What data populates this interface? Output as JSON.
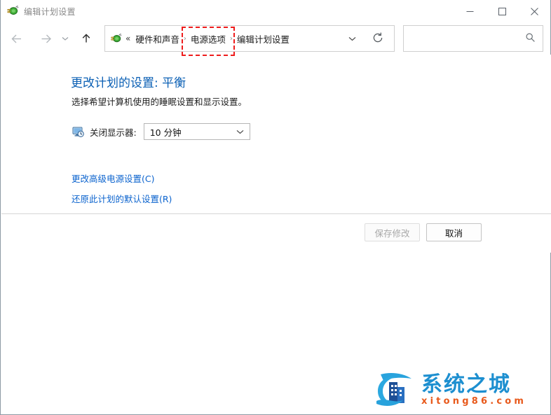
{
  "window": {
    "title": "编辑计划设置",
    "title_icon": "power-plug-icon",
    "controls": {
      "minimize_label": "—",
      "maximize_label": "□",
      "close_label": "✕"
    }
  },
  "navbar": {
    "back_icon": "arrow-left-icon",
    "forward_icon": "arrow-right-icon",
    "recent_icon": "chevron-down-small-icon",
    "up_icon": "arrow-up-icon",
    "address": {
      "icon": "power-plug-icon",
      "overflow_label": "«",
      "crumbs": [
        {
          "label": "硬件和声音"
        },
        {
          "label": "电源选项"
        },
        {
          "label": "编辑计划设置"
        }
      ],
      "separator": "›",
      "dropdown_icon": "chevron-down-icon",
      "refresh_icon": "refresh-icon"
    },
    "search": {
      "value": "",
      "placeholder": "",
      "icon": "search-icon"
    }
  },
  "annotation": {
    "name": "red-dashed-highlight",
    "target": "电源选项",
    "color": "#ee1c1c"
  },
  "content": {
    "heading": "更改计划的设置: 平衡",
    "subtitle": "选择希望计算机使用的睡眠设置和显示设置。",
    "setting": {
      "icon": "monitor-clock-icon",
      "label": "关闭显示器:",
      "value": "10 分钟",
      "chevron_icon": "chevron-down-icon"
    },
    "links": [
      {
        "label": "更改高级电源设置(C)"
      },
      {
        "label": "还原此计划的默认设置(R)"
      }
    ]
  },
  "commands": {
    "save_label": "保存修改",
    "save_enabled": false,
    "cancel_label": "取消",
    "cancel_enabled": true
  },
  "watermark": {
    "title": "系统之城",
    "subtitle": "xitong86.com",
    "logo_icon": "building-wave-logo-icon",
    "title_color": "#1d8fd0",
    "subtitle_color": "#e8591b"
  }
}
